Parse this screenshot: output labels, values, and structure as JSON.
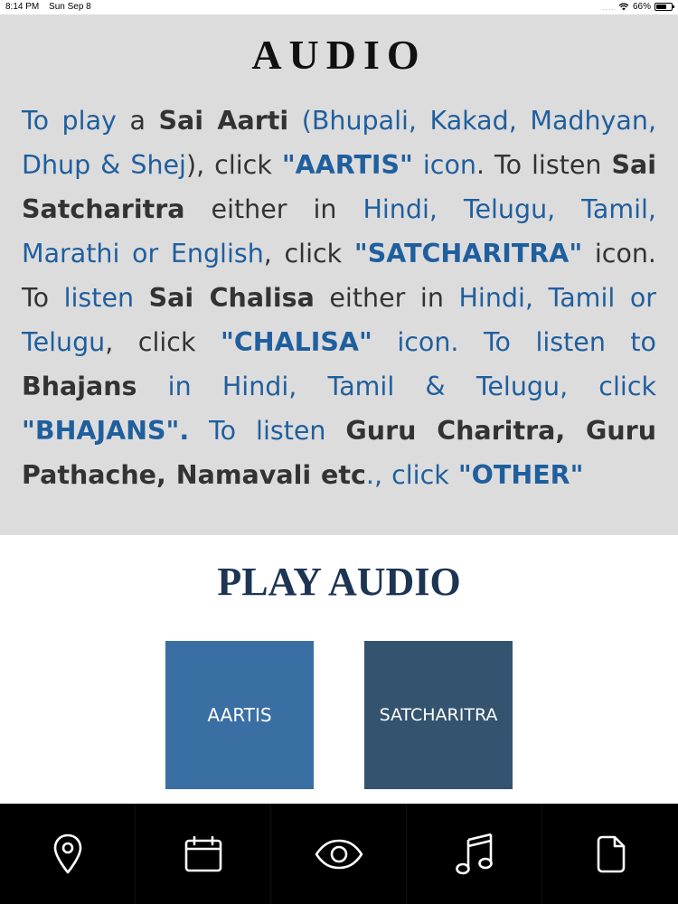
{
  "status_bar": {
    "time": "8:14 PM",
    "date": "Sun Sep 8",
    "signal": "....",
    "battery_text": "66%",
    "battery_level": 0.66
  },
  "intro": {
    "title": "AUDIO",
    "text": [
      {
        "t": "To play",
        "s": "blue"
      },
      {
        "t": " a ",
        "s": "plain"
      },
      {
        "t": "Sai Aarti",
        "s": "bold"
      },
      {
        "t": " (Bhupali, Kakad, Madhyan, Dhup & Shej",
        "s": "blue"
      },
      {
        "t": "), click ",
        "s": "plain"
      },
      {
        "t": "\"AARTIS\"",
        "s": "bold-blue"
      },
      {
        "t": " icon",
        "s": "blue"
      },
      {
        "t": ". To listen ",
        "s": "plain"
      },
      {
        "t": "Sai Satcharitra",
        "s": "bold"
      },
      {
        "t": " either in ",
        "s": "plain"
      },
      {
        "t": "Hindi, Telugu, Tamil, Marathi or English",
        "s": "blue"
      },
      {
        "t": ", click ",
        "s": "plain"
      },
      {
        "t": "\"SATCHARITRA\"",
        "s": "bold-blue"
      },
      {
        "t": " icon. To ",
        "s": "plain"
      },
      {
        "t": "listen",
        "s": "blue"
      },
      {
        "t": " ",
        "s": "plain"
      },
      {
        "t": "Sai Chalisa",
        "s": "bold"
      },
      {
        "t": " either in ",
        "s": "plain"
      },
      {
        "t": "Hindi, Tamil or Telugu",
        "s": "blue"
      },
      {
        "t": ", click ",
        "s": "plain"
      },
      {
        "t": "\"CHALISA\"",
        "s": "bold-blue"
      },
      {
        "t": " icon. To listen to ",
        "s": "blue"
      },
      {
        "t": "Bhajans",
        "s": "bold"
      },
      {
        "t": " in Hindi, Tamil & Telugu, click ",
        "s": "blue"
      },
      {
        "t": "\"BHAJANS\".",
        "s": "bold-blue"
      },
      {
        "t": " To listen ",
        "s": "blue"
      },
      {
        "t": "Guru Charitra, Guru Pathache, Namavali etc",
        "s": "bold"
      },
      {
        "t": "., click ",
        "s": "blue"
      },
      {
        "t": "\"OTHER\"",
        "s": "bold-blue"
      }
    ]
  },
  "play_section": {
    "title": "PLAY AUDIO",
    "tiles": [
      {
        "label": "AARTIS",
        "color": "#3a6fa3"
      },
      {
        "label": "SATCHARITRA",
        "color": "#34536f"
      }
    ]
  },
  "tab_bar": {
    "items": [
      {
        "icon": "location-pin-icon"
      },
      {
        "icon": "calendar-icon"
      },
      {
        "icon": "eye-icon"
      },
      {
        "icon": "music-note-icon"
      },
      {
        "icon": "document-icon"
      }
    ]
  },
  "colors": {
    "panel_bg": "#dddcdd",
    "link_blue": "#1f5f9e",
    "title_navy": "#1c3552",
    "tab_bar_bg": "#000000"
  }
}
